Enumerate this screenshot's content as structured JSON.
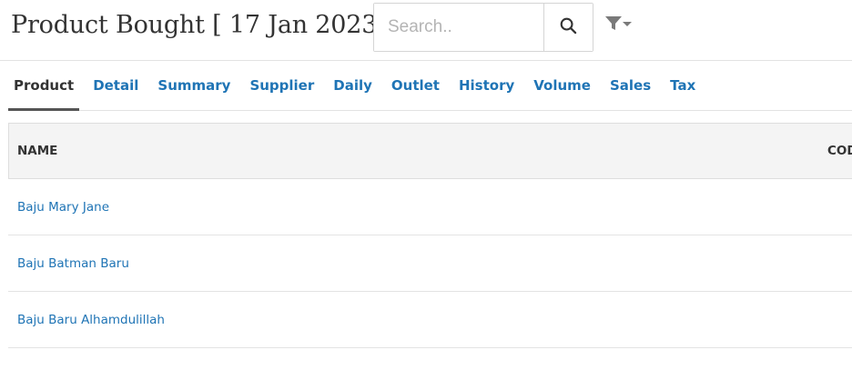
{
  "header": {
    "title": "Product Bought [ 17 Jan 2023 ]",
    "search_placeholder": "Search..",
    "search_icon": "search-icon",
    "filter_icon": "filter-icon"
  },
  "tabs": [
    {
      "label": "Product",
      "active": true
    },
    {
      "label": "Detail"
    },
    {
      "label": "Summary"
    },
    {
      "label": "Supplier"
    },
    {
      "label": "Daily"
    },
    {
      "label": "Outlet"
    },
    {
      "label": "History"
    },
    {
      "label": "Volume"
    },
    {
      "label": "Sales"
    },
    {
      "label": "Tax"
    }
  ],
  "table": {
    "columns": [
      "NAME",
      "COD"
    ],
    "rows": [
      {
        "name": "Baju Mary Jane"
      },
      {
        "name": "Baju Batman Baru"
      },
      {
        "name": "Baju Baru Alhamdulillah"
      }
    ]
  },
  "colors": {
    "link": "#1f74b5",
    "active_tab_underline": "#555555",
    "header_bg": "#f4f4f4"
  }
}
